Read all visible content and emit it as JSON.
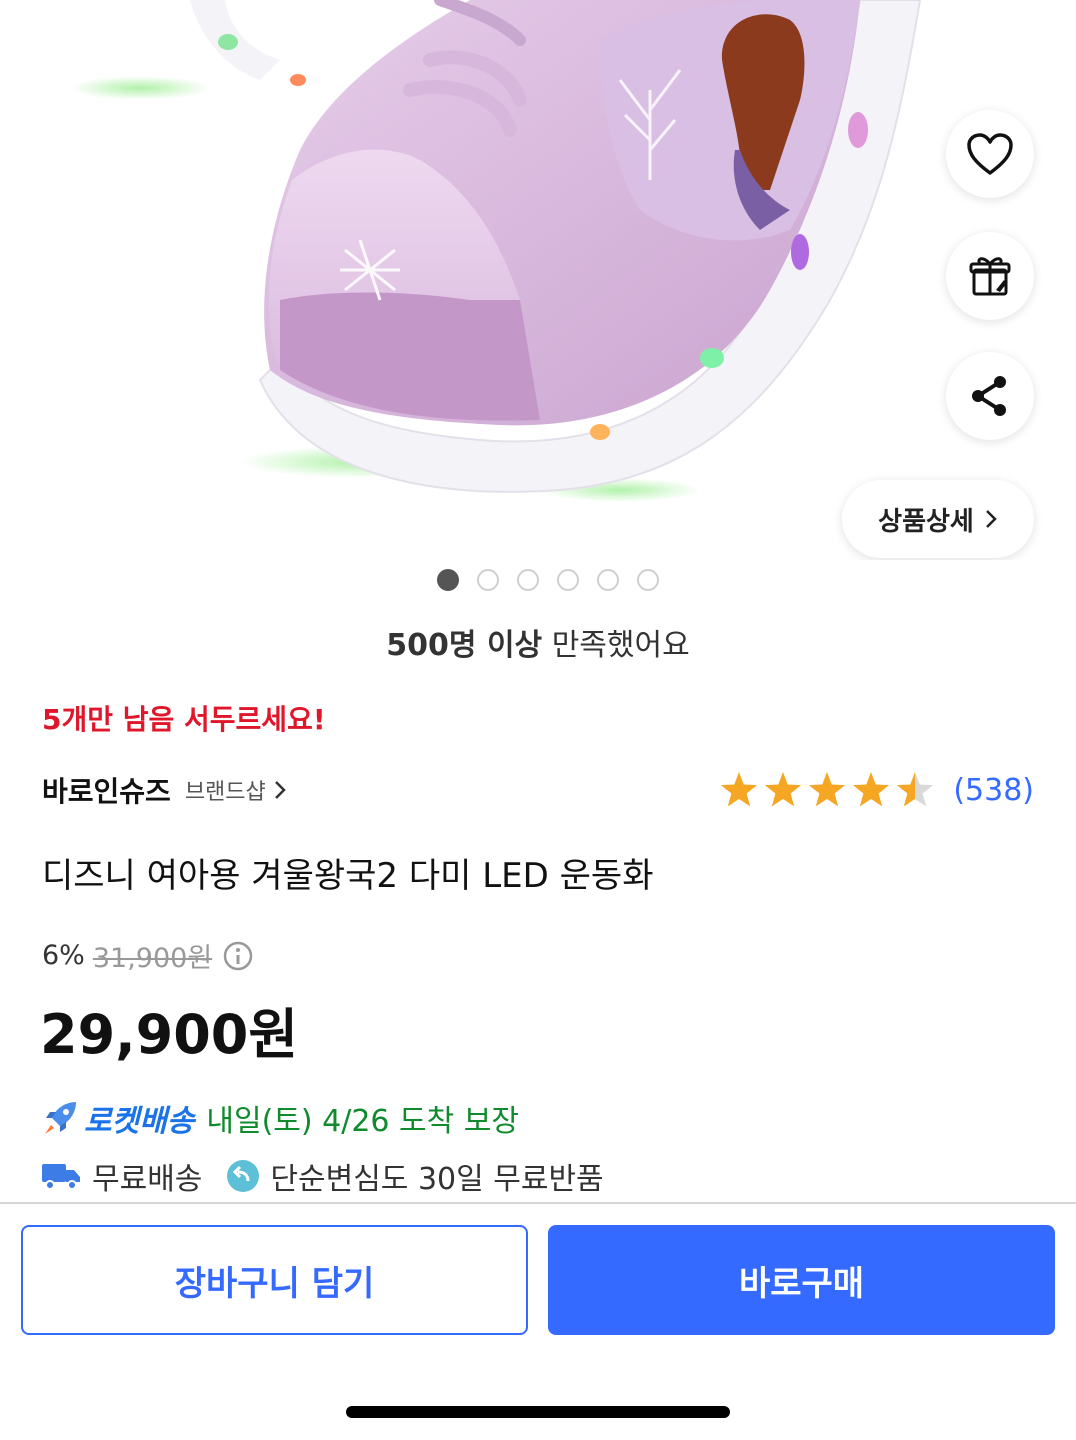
{
  "hero": {
    "detail_button_label": "상품상세",
    "dot_count": 6,
    "active_dot": 0
  },
  "satisfaction": {
    "strong": "500명 이상",
    "rest": "만족했어요"
  },
  "stock_alert": "5개만 남음 서두르세요!",
  "brand": {
    "name": "바로인슈즈",
    "shop_link": "브랜드샵"
  },
  "rating": {
    "stars": 4.5,
    "review_count": "(538)"
  },
  "product_title": "디즈니 여아용 겨울왕국2 다미 LED 운동화",
  "pricing": {
    "discount_rate": "6%",
    "original_price": "31,900원",
    "sale_price": "29,900원"
  },
  "delivery": {
    "rocket_label": "로켓배송",
    "arrival_text": "내일(토) 4/26 도착 보장",
    "free_shipping": "무료배송",
    "free_return": "단순변심도 30일 무료반품"
  },
  "actions": {
    "cart_label": "장바구니 담기",
    "buy_label": "바로구매"
  },
  "colors": {
    "accent_blue": "#346aff",
    "alert_red": "#e0162b",
    "arrival_green": "#0f8a2d",
    "star_yellow": "#f5a623"
  }
}
